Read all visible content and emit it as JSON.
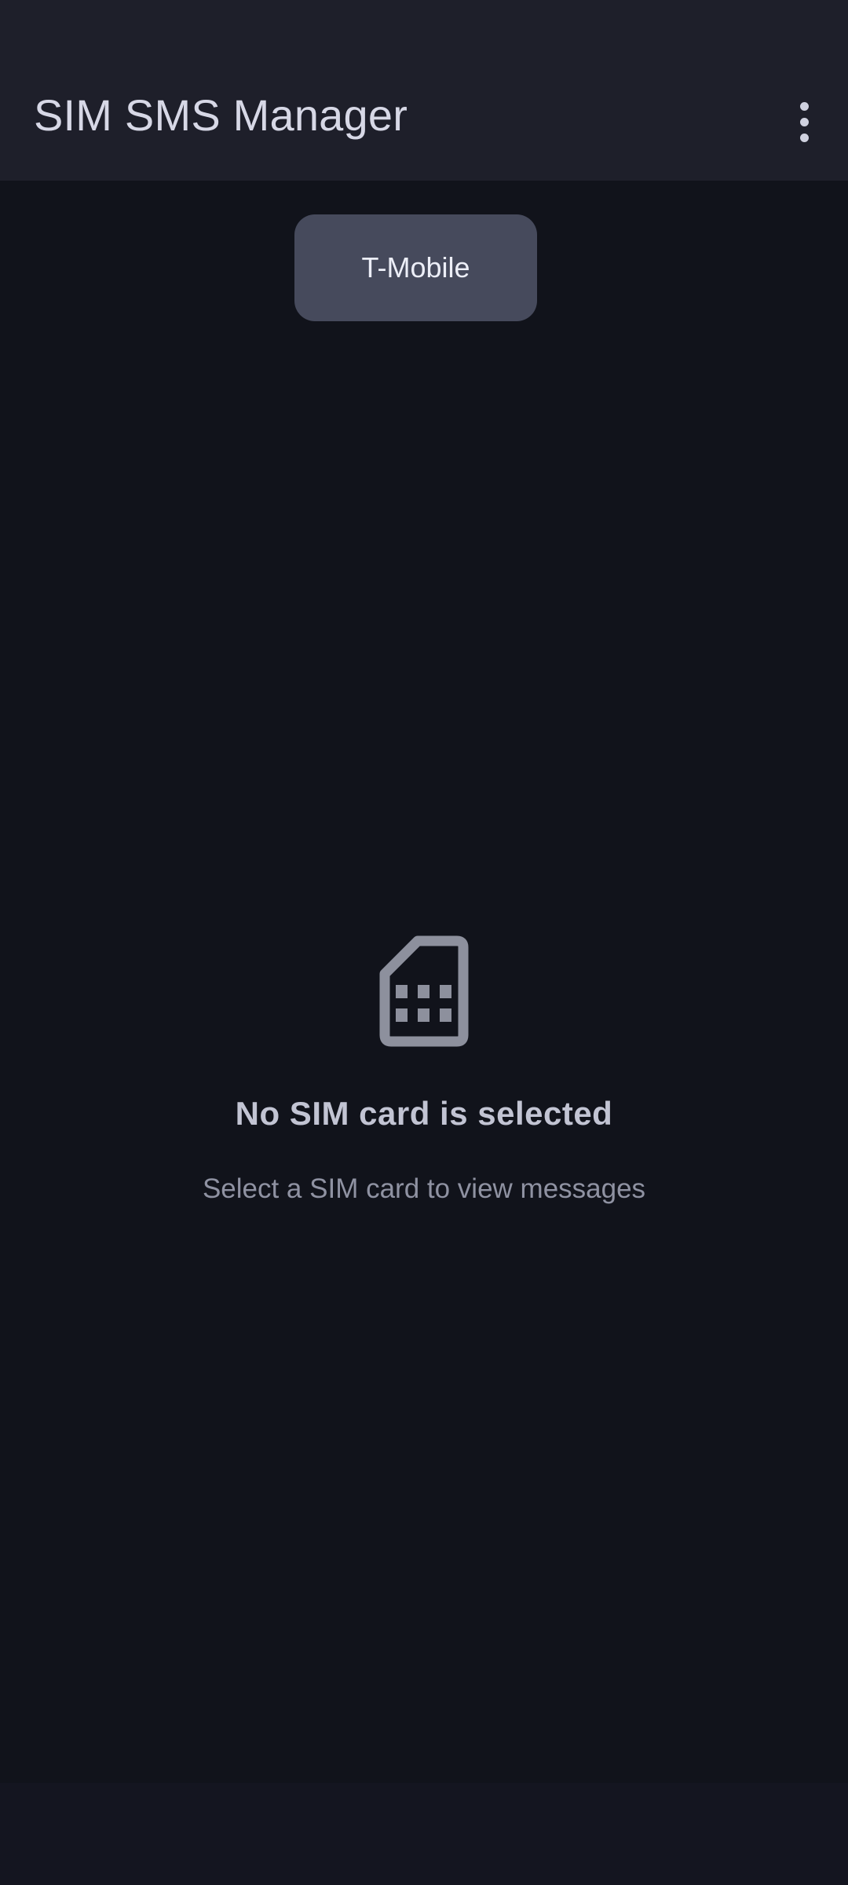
{
  "app_bar": {
    "title": "SIM SMS Manager",
    "overflow_icon": "more-vert-icon"
  },
  "sim_selector": {
    "chips": [
      {
        "label": "T-Mobile"
      }
    ]
  },
  "empty_state": {
    "icon": "sim-card-icon",
    "title": "No SIM card is selected",
    "subtitle": "Select a SIM card to view messages"
  },
  "colors": {
    "background": "#11131b",
    "app_bar": "#1e1f2a",
    "chip": "#464a5c",
    "icon": "#8d909d"
  }
}
